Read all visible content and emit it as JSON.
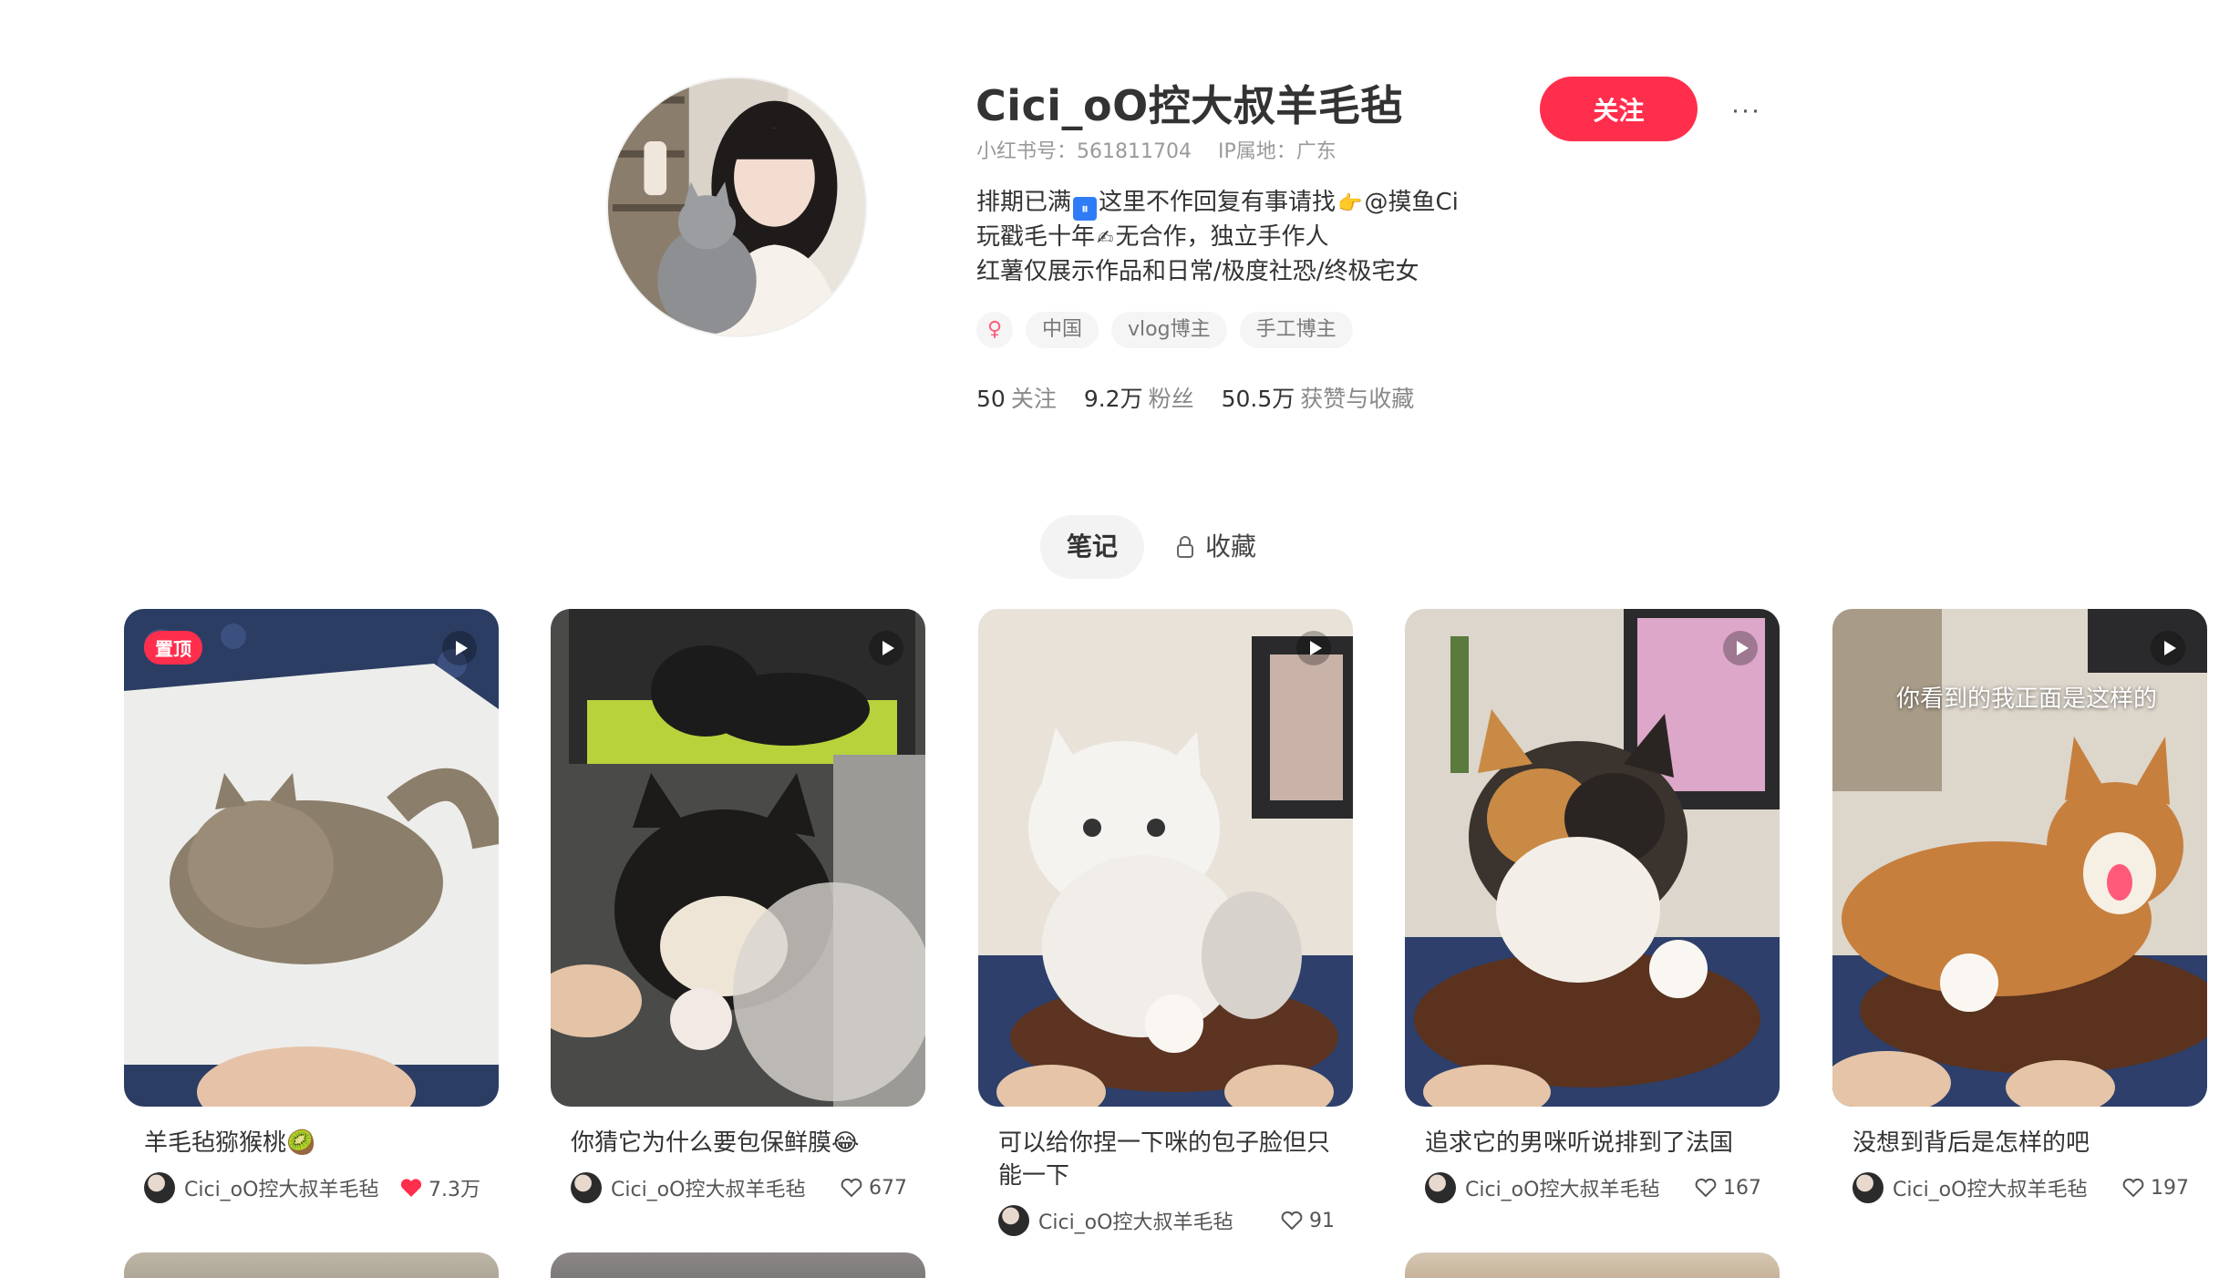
{
  "profile": {
    "name": "Cici_oO控大叔羊毛毡",
    "id_label": "小红书号：561811704",
    "ip_label": "IP属地：广东",
    "follow_label": "关注",
    "more_label": "···",
    "bio": {
      "line1_a": "排期已满",
      "line1_badge": "⏸",
      "line1_b": "这里不作回复有事请找",
      "line1_icon": "👉",
      "line1_c": "@摸鱼Ci",
      "line2_a": "玩戳毛十年",
      "line2_icon": "✍",
      "line2_b": "无合作，独立手作人",
      "line3": "红薯仅展示作品和日常/极度社恐/终极宅女"
    },
    "tags": {
      "gender": "♀",
      "region": "中国",
      "vlog": "vlog博主",
      "craft": "手工博主"
    },
    "stats": {
      "following_num": "50",
      "following_label": "关注",
      "fans_num": "9.2万",
      "fans_label": "粉丝",
      "likes_num": "50.5万",
      "likes_label": "获赞与收藏"
    }
  },
  "tabs": {
    "notes": "笔记",
    "collect": "收藏"
  },
  "notes": [
    {
      "title": "羊毛毡猕猴桃🥝",
      "author": "Cici_oO控大叔羊毛毡",
      "likes": "7.3万",
      "pinned": "置顶",
      "liked": true
    },
    {
      "title": "你猜它为什么要包保鲜膜😂",
      "author": "Cici_oO控大叔羊毛毡",
      "likes": "677",
      "liked": false
    },
    {
      "title": "可以给你捏一下咪的包子脸但只能一下",
      "author": "Cici_oO控大叔羊毛毡",
      "likes": "91",
      "liked": false
    },
    {
      "title": "追求它的男咪听说排到了法国",
      "author": "Cici_oO控大叔羊毛毡",
      "likes": "167",
      "liked": false
    },
    {
      "title": "没想到背后是怎样的吧",
      "author": "Cici_oO控大叔羊毛毡",
      "likes": "197",
      "liked": false,
      "cover_caption": "你看到的我正面是这样的"
    }
  ],
  "colors": {
    "accent": "#ff2e4d",
    "text": "#333333",
    "muted": "#9a9a9a"
  }
}
